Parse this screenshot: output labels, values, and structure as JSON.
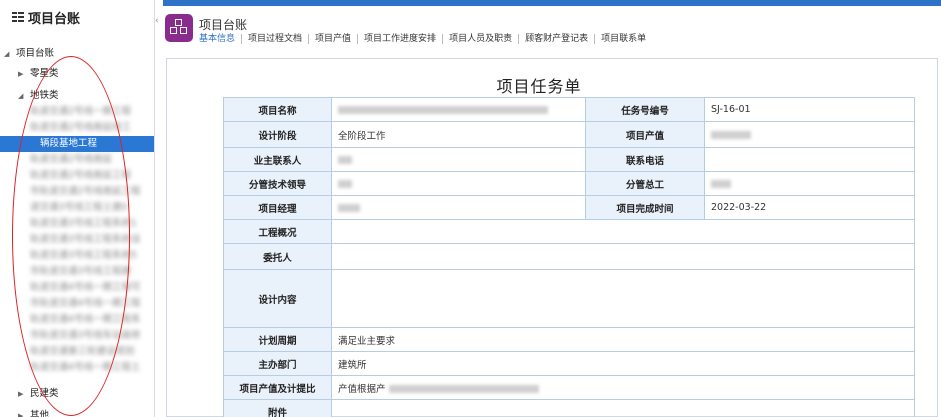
{
  "sidebar": {
    "title": "项目台账",
    "items": [
      {
        "label": "项目台账",
        "level": 0,
        "expanded": true
      },
      {
        "label": "零星类",
        "level": 1,
        "expanded": false
      },
      {
        "label": "地铁类",
        "level": 1,
        "expanded": true
      },
      {
        "label": "轨道交通2号线一期工程",
        "level": 2,
        "blurred": true
      },
      {
        "label": "轨道交通2号线南延线工",
        "level": 2,
        "blurred": true
      },
      {
        "label": "辆段基地工程",
        "level": 3,
        "selected": true
      },
      {
        "label": "轨道交通2号线南延",
        "level": 2,
        "blurred": true
      },
      {
        "label": "轨道交通2号线南延工程",
        "level": 2,
        "blurred": true
      },
      {
        "label": "市轨道交通2号线南延工程",
        "level": 2,
        "blurred": true
      },
      {
        "label": "道交通3号线工程土建0",
        "level": 2,
        "blurred": true
      },
      {
        "label": "轨道交通3号线工程系统1",
        "level": 2,
        "blurred": true
      },
      {
        "label": "轨道交通3号线工程系统设",
        "level": 2,
        "blurred": true
      },
      {
        "label": "轨道交通3号线工程系统5",
        "level": 2,
        "blurred": true
      },
      {
        "label": "市轨道交通3号线工程建",
        "level": 2,
        "blurred": true
      },
      {
        "label": "轨道交通4号线一期工程可",
        "level": 2,
        "blurred": true
      },
      {
        "label": "市轨道交通4号线一期工程",
        "level": 2,
        "blurred": true
      },
      {
        "label": "轨道交通4号线一期工程系",
        "level": 2,
        "blurred": true
      },
      {
        "label": "市轨道交通3号线车站装修",
        "level": 2,
        "blurred": true
      },
      {
        "label": "轨道交通第三轮建设规划",
        "level": 2,
        "blurred": true
      },
      {
        "label": "轨道交通4号线一期工程土",
        "level": 2,
        "blurred": true
      },
      {
        "label": "民建类",
        "level": 1,
        "expanded": false
      },
      {
        "label": "其他",
        "level": 1,
        "expanded": false
      }
    ]
  },
  "header": {
    "title": "项目台账",
    "tabs": [
      "基本信息",
      "项目过程文档",
      "项目产值",
      "项目工作进度安排",
      "项目人员及职责",
      "顾客财产登记表",
      "项目联系单"
    ],
    "active_tab": 0
  },
  "document": {
    "title": "项目任务单",
    "labels": {
      "project_name": "项目名称",
      "task_no": "任务号编号",
      "design_stage": "设计阶段",
      "project_value": "项目产值",
      "owner_contact": "业主联系人",
      "phone": "联系电话",
      "tech_lead": "分管技术领导",
      "chief_engineer": "分管总工",
      "project_manager": "项目经理",
      "completion_time": "项目完成时间",
      "overview": "工程概况",
      "client": "委托人",
      "design_content": "设计内容",
      "plan_period": "计划周期",
      "host_dept": "主办部门",
      "value_ratio": "项目产值及计提比",
      "attachment": "附件"
    },
    "values": {
      "task_no": "SJ-16-01",
      "design_stage": "全阶段工作",
      "completion_time": "2022-03-22",
      "plan_period": "满足业主要求",
      "host_dept": "建筑所",
      "value_ratio": "产值根据产"
    }
  }
}
